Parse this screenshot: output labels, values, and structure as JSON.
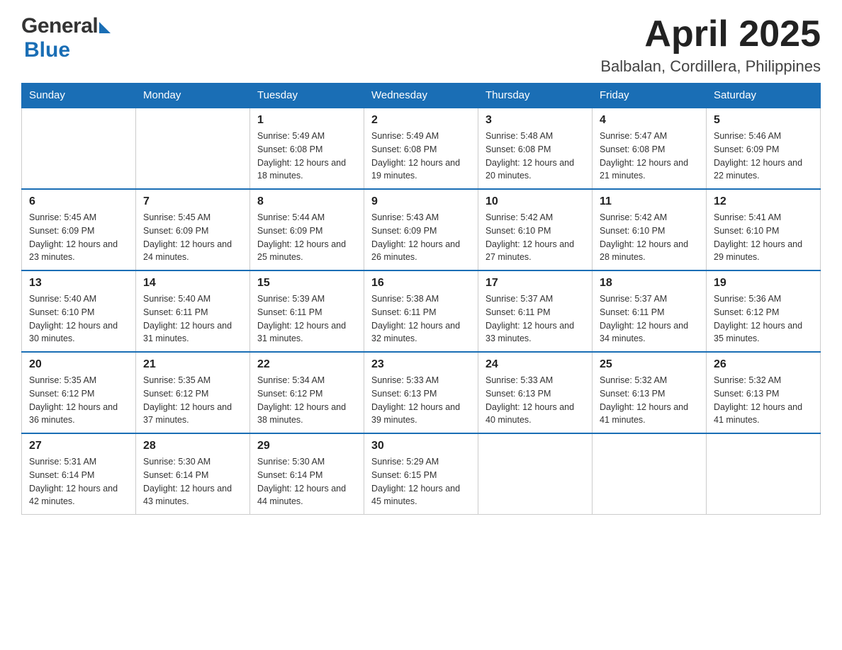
{
  "header": {
    "title": "April 2025",
    "location": "Balbalan, Cordillera, Philippines",
    "logo_general": "General",
    "logo_blue": "Blue"
  },
  "weekdays": [
    "Sunday",
    "Monday",
    "Tuesday",
    "Wednesday",
    "Thursday",
    "Friday",
    "Saturday"
  ],
  "weeks": [
    [
      {
        "day": "",
        "sunrise": "",
        "sunset": "",
        "daylight": ""
      },
      {
        "day": "",
        "sunrise": "",
        "sunset": "",
        "daylight": ""
      },
      {
        "day": "1",
        "sunrise": "Sunrise: 5:49 AM",
        "sunset": "Sunset: 6:08 PM",
        "daylight": "Daylight: 12 hours and 18 minutes."
      },
      {
        "day": "2",
        "sunrise": "Sunrise: 5:49 AM",
        "sunset": "Sunset: 6:08 PM",
        "daylight": "Daylight: 12 hours and 19 minutes."
      },
      {
        "day": "3",
        "sunrise": "Sunrise: 5:48 AM",
        "sunset": "Sunset: 6:08 PM",
        "daylight": "Daylight: 12 hours and 20 minutes."
      },
      {
        "day": "4",
        "sunrise": "Sunrise: 5:47 AM",
        "sunset": "Sunset: 6:08 PM",
        "daylight": "Daylight: 12 hours and 21 minutes."
      },
      {
        "day": "5",
        "sunrise": "Sunrise: 5:46 AM",
        "sunset": "Sunset: 6:09 PM",
        "daylight": "Daylight: 12 hours and 22 minutes."
      }
    ],
    [
      {
        "day": "6",
        "sunrise": "Sunrise: 5:45 AM",
        "sunset": "Sunset: 6:09 PM",
        "daylight": "Daylight: 12 hours and 23 minutes."
      },
      {
        "day": "7",
        "sunrise": "Sunrise: 5:45 AM",
        "sunset": "Sunset: 6:09 PM",
        "daylight": "Daylight: 12 hours and 24 minutes."
      },
      {
        "day": "8",
        "sunrise": "Sunrise: 5:44 AM",
        "sunset": "Sunset: 6:09 PM",
        "daylight": "Daylight: 12 hours and 25 minutes."
      },
      {
        "day": "9",
        "sunrise": "Sunrise: 5:43 AM",
        "sunset": "Sunset: 6:09 PM",
        "daylight": "Daylight: 12 hours and 26 minutes."
      },
      {
        "day": "10",
        "sunrise": "Sunrise: 5:42 AM",
        "sunset": "Sunset: 6:10 PM",
        "daylight": "Daylight: 12 hours and 27 minutes."
      },
      {
        "day": "11",
        "sunrise": "Sunrise: 5:42 AM",
        "sunset": "Sunset: 6:10 PM",
        "daylight": "Daylight: 12 hours and 28 minutes."
      },
      {
        "day": "12",
        "sunrise": "Sunrise: 5:41 AM",
        "sunset": "Sunset: 6:10 PM",
        "daylight": "Daylight: 12 hours and 29 minutes."
      }
    ],
    [
      {
        "day": "13",
        "sunrise": "Sunrise: 5:40 AM",
        "sunset": "Sunset: 6:10 PM",
        "daylight": "Daylight: 12 hours and 30 minutes."
      },
      {
        "day": "14",
        "sunrise": "Sunrise: 5:40 AM",
        "sunset": "Sunset: 6:11 PM",
        "daylight": "Daylight: 12 hours and 31 minutes."
      },
      {
        "day": "15",
        "sunrise": "Sunrise: 5:39 AM",
        "sunset": "Sunset: 6:11 PM",
        "daylight": "Daylight: 12 hours and 31 minutes."
      },
      {
        "day": "16",
        "sunrise": "Sunrise: 5:38 AM",
        "sunset": "Sunset: 6:11 PM",
        "daylight": "Daylight: 12 hours and 32 minutes."
      },
      {
        "day": "17",
        "sunrise": "Sunrise: 5:37 AM",
        "sunset": "Sunset: 6:11 PM",
        "daylight": "Daylight: 12 hours and 33 minutes."
      },
      {
        "day": "18",
        "sunrise": "Sunrise: 5:37 AM",
        "sunset": "Sunset: 6:11 PM",
        "daylight": "Daylight: 12 hours and 34 minutes."
      },
      {
        "day": "19",
        "sunrise": "Sunrise: 5:36 AM",
        "sunset": "Sunset: 6:12 PM",
        "daylight": "Daylight: 12 hours and 35 minutes."
      }
    ],
    [
      {
        "day": "20",
        "sunrise": "Sunrise: 5:35 AM",
        "sunset": "Sunset: 6:12 PM",
        "daylight": "Daylight: 12 hours and 36 minutes."
      },
      {
        "day": "21",
        "sunrise": "Sunrise: 5:35 AM",
        "sunset": "Sunset: 6:12 PM",
        "daylight": "Daylight: 12 hours and 37 minutes."
      },
      {
        "day": "22",
        "sunrise": "Sunrise: 5:34 AM",
        "sunset": "Sunset: 6:12 PM",
        "daylight": "Daylight: 12 hours and 38 minutes."
      },
      {
        "day": "23",
        "sunrise": "Sunrise: 5:33 AM",
        "sunset": "Sunset: 6:13 PM",
        "daylight": "Daylight: 12 hours and 39 minutes."
      },
      {
        "day": "24",
        "sunrise": "Sunrise: 5:33 AM",
        "sunset": "Sunset: 6:13 PM",
        "daylight": "Daylight: 12 hours and 40 minutes."
      },
      {
        "day": "25",
        "sunrise": "Sunrise: 5:32 AM",
        "sunset": "Sunset: 6:13 PM",
        "daylight": "Daylight: 12 hours and 41 minutes."
      },
      {
        "day": "26",
        "sunrise": "Sunrise: 5:32 AM",
        "sunset": "Sunset: 6:13 PM",
        "daylight": "Daylight: 12 hours and 41 minutes."
      }
    ],
    [
      {
        "day": "27",
        "sunrise": "Sunrise: 5:31 AM",
        "sunset": "Sunset: 6:14 PM",
        "daylight": "Daylight: 12 hours and 42 minutes."
      },
      {
        "day": "28",
        "sunrise": "Sunrise: 5:30 AM",
        "sunset": "Sunset: 6:14 PM",
        "daylight": "Daylight: 12 hours and 43 minutes."
      },
      {
        "day": "29",
        "sunrise": "Sunrise: 5:30 AM",
        "sunset": "Sunset: 6:14 PM",
        "daylight": "Daylight: 12 hours and 44 minutes."
      },
      {
        "day": "30",
        "sunrise": "Sunrise: 5:29 AM",
        "sunset": "Sunset: 6:15 PM",
        "daylight": "Daylight: 12 hours and 45 minutes."
      },
      {
        "day": "",
        "sunrise": "",
        "sunset": "",
        "daylight": ""
      },
      {
        "day": "",
        "sunrise": "",
        "sunset": "",
        "daylight": ""
      },
      {
        "day": "",
        "sunrise": "",
        "sunset": "",
        "daylight": ""
      }
    ]
  ]
}
